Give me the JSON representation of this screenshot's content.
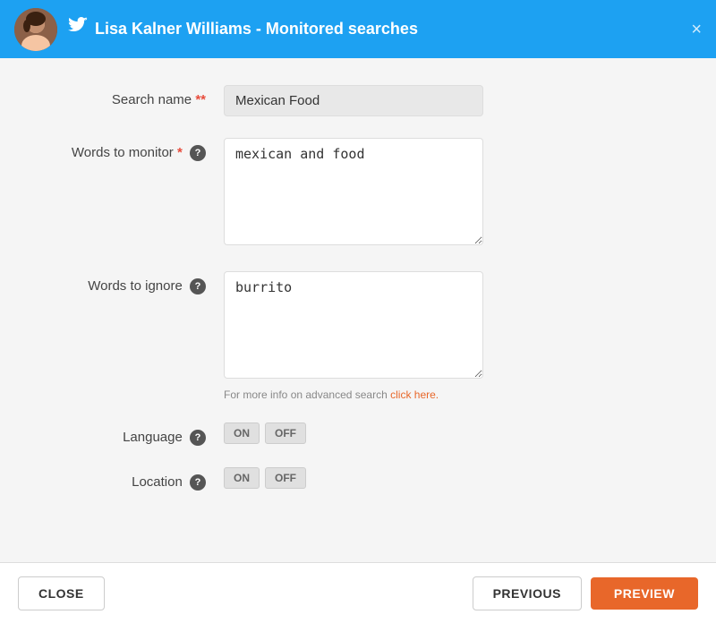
{
  "header": {
    "title": "Lisa Kalner Williams - Monitored searches",
    "close_icon_label": "×"
  },
  "form": {
    "search_name_label": "Search name",
    "search_name_required": "**",
    "search_name_value": "Mexican Food",
    "words_to_monitor_label": "Words to monitor",
    "words_to_monitor_required": "*",
    "words_to_monitor_value": "mexican and food",
    "words_to_ignore_label": "Words to ignore",
    "words_to_ignore_value": "burrito",
    "advanced_note": "For more info on advanced search ",
    "advanced_link": "click here.",
    "language_label": "Language",
    "location_label": "Location",
    "toggle_on": "ON",
    "toggle_off": "OFF"
  },
  "footer": {
    "close_label": "CLOSE",
    "previous_label": "PREVIOUS",
    "preview_label": "PREVIEW"
  }
}
